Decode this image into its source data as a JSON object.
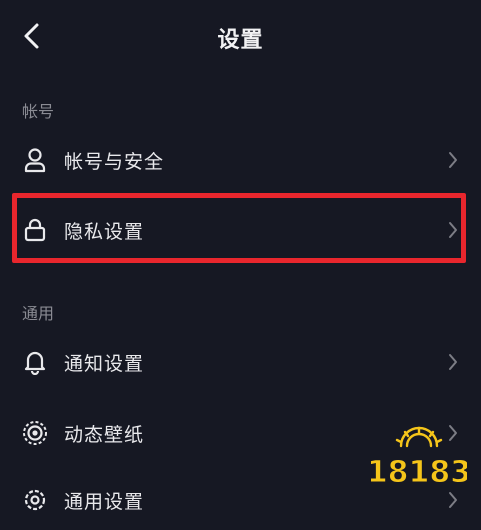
{
  "header": {
    "title": "设置"
  },
  "sections": [
    {
      "label": "帐号",
      "items": [
        {
          "label": "帐号与安全",
          "icon": "person-icon"
        },
        {
          "label": "隐私设置",
          "icon": "lock-icon"
        }
      ]
    },
    {
      "label": "通用",
      "items": [
        {
          "label": "通知设置",
          "icon": "bell-icon"
        },
        {
          "label": "动态壁纸",
          "icon": "target-icon"
        },
        {
          "label": "通用设置",
          "icon": "gear-icon"
        }
      ]
    }
  ],
  "watermark": {
    "text": "18183"
  },
  "colors": {
    "background": "#161823",
    "highlight": "#e8262d",
    "watermark": "#f5c51a"
  }
}
